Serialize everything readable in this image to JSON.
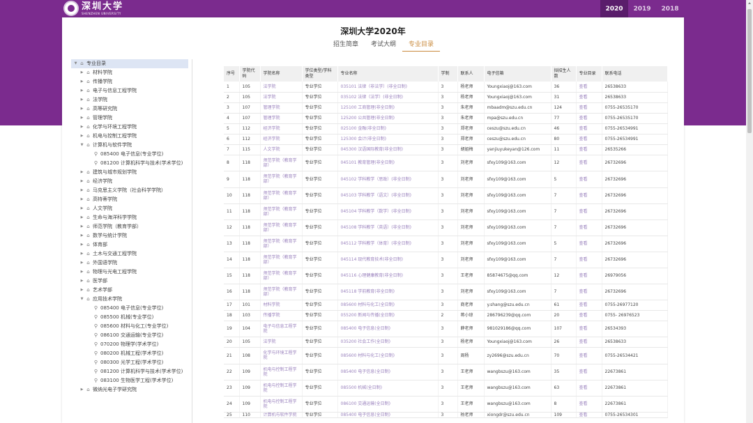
{
  "header": {
    "logo_cn": "深圳大学",
    "logo_en": "SHENZHEN UNIVERSITY",
    "years": [
      "2020",
      "2019",
      "2018"
    ],
    "active_year": "2020"
  },
  "page": {
    "title": "深圳大学2020年",
    "tabs": [
      "招生简章",
      "考试大纲",
      "专业目录"
    ],
    "active_tab": "专业目录"
  },
  "tree": {
    "root": "专业目录",
    "items": [
      {
        "label": "材料学院",
        "level": 1,
        "expanded": false
      },
      {
        "label": "传播学院",
        "level": 1,
        "expanded": false
      },
      {
        "label": "电子与信息工程学院",
        "level": 1,
        "expanded": false
      },
      {
        "label": "法学院",
        "level": 1,
        "expanded": false
      },
      {
        "label": "高等研究院",
        "level": 1,
        "expanded": false
      },
      {
        "label": "管理学院",
        "level": 1,
        "expanded": false
      },
      {
        "label": "化学与环境工程学院",
        "level": 1,
        "expanded": false
      },
      {
        "label": "机电与控制工程学院",
        "level": 1,
        "expanded": false
      },
      {
        "label": "计算机与软件学院",
        "level": 1,
        "expanded": true
      },
      {
        "label": "085400 电子信息(专业学位)",
        "level": 2
      },
      {
        "label": "081200 计算机科学与技术(学术学位)",
        "level": 2
      },
      {
        "label": "建筑与城市规划学院",
        "level": 1,
        "expanded": false
      },
      {
        "label": "经济学院",
        "level": 1,
        "expanded": false
      },
      {
        "label": "马克思主义学院（社会科学学院）",
        "level": 1,
        "expanded": false
      },
      {
        "label": "高特蒂学院",
        "level": 1,
        "expanded": false
      },
      {
        "label": "人文学院",
        "level": 1,
        "expanded": false
      },
      {
        "label": "生命与海洋科学学院",
        "level": 1,
        "expanded": false
      },
      {
        "label": "师范学院（教育学部）",
        "level": 1,
        "expanded": false
      },
      {
        "label": "数学与统计学院",
        "level": 1,
        "expanded": false
      },
      {
        "label": "体育部",
        "level": 1,
        "expanded": false
      },
      {
        "label": "土木与交通工程学院",
        "level": 1,
        "expanded": false
      },
      {
        "label": "外国语学院",
        "level": 1,
        "expanded": false
      },
      {
        "label": "物理与光电工程学院",
        "level": 1,
        "expanded": false
      },
      {
        "label": "医学部",
        "level": 1,
        "expanded": false
      },
      {
        "label": "艺术学部",
        "level": 1,
        "expanded": false
      },
      {
        "label": "应用技术学院",
        "level": 1,
        "expanded": true
      },
      {
        "label": "085400 电子信息(专业学位)",
        "level": 2
      },
      {
        "label": "085500 机械(专业学位)",
        "level": 2
      },
      {
        "label": "085600 材料与化工(专业学位)",
        "level": 2
      },
      {
        "label": "086100 交通运输(专业学位)",
        "level": 2
      },
      {
        "label": "070200 物理学(学术学位)",
        "level": 2
      },
      {
        "label": "080200 机械工程(学术学位)",
        "level": 2
      },
      {
        "label": "080300 光学工程(学术学位)",
        "level": 2
      },
      {
        "label": "081200 计算机科学与技术(学术学位)",
        "level": 2
      },
      {
        "label": "083100 生物医学工程(学术学位)",
        "level": 2
      },
      {
        "label": "微纳光电子学研究院",
        "level": 1,
        "expanded": false
      }
    ]
  },
  "table": {
    "headers": [
      "序号",
      "学院代码",
      "学院名称",
      "学位类型/学科类型",
      "专业名称",
      "学制",
      "联系人",
      "电子信箱",
      "拟招生人数",
      "专业目录",
      "联系电话"
    ],
    "rows": [
      {
        "h": 15,
        "cells": [
          "1",
          "105",
          "法学院",
          "专业学位",
          "035101 法律（非法学）(非全日制)",
          "3",
          "杨老师",
          "Youngxiaoj@163.com",
          "36",
          "查看",
          "26538633"
        ]
      },
      {
        "h": 15,
        "cells": [
          "2",
          "105",
          "法学院",
          "专业学位",
          "035102 法律（法学）(非全日制)",
          "3",
          "杨老师",
          "Youngxiaoj@163.com",
          "31",
          "查看",
          "26538633"
        ]
      },
      {
        "h": 15,
        "cells": [
          "3",
          "107",
          "管理学院",
          "专业学位",
          "125100 工商管理(非全日制)",
          "3",
          "朱老师",
          "mbaadm@szu.edu.cn",
          "124",
          "查看",
          "0755-26535170"
        ]
      },
      {
        "h": 15,
        "cells": [
          "4",
          "107",
          "管理学院",
          "专业学位",
          "125200 公共管理(非全日制)",
          "3",
          "朱老师",
          "mpa@szu.edu.cn",
          "77",
          "查看",
          "0755-26535170"
        ]
      },
      {
        "h": 15,
        "cells": [
          "5",
          "112",
          "经济学院",
          "专业学位",
          "025100 金融(非全日制)",
          "3",
          "郑老师",
          "ceszu@szu.edu.cn",
          "46",
          "查看",
          "0755-26534991"
        ]
      },
      {
        "h": 15,
        "cells": [
          "6",
          "112",
          "经济学院",
          "专业学位",
          "125300 会计(非全日制)",
          "3",
          "郑老师",
          "ceszu@szu.edu.cn",
          "80",
          "查看",
          "0755-26534991"
        ]
      },
      {
        "h": 15,
        "cells": [
          "7",
          "115",
          "人文学院",
          "专业学位",
          "045300 汉语国际教育(非全日制)",
          "3",
          "胡姐梅",
          "yanjiuyukeyan@126.com",
          "11",
          "查看",
          "26535266"
        ]
      },
      {
        "h": 23,
        "cells": [
          "8",
          "118",
          "师范学院（教育学部）",
          "专业学位",
          "045101 教育管理(非全日制)",
          "3",
          "刘老师",
          "sfxy109@163.com",
          "12",
          "查看",
          "26732696"
        ]
      },
      {
        "h": 24,
        "cells": [
          "9",
          "118",
          "师范学院（教育学部）",
          "专业学位",
          "045102 学科教学（思政）(非全日制)",
          "3",
          "刘老师",
          "sfxy109@163.com",
          "5",
          "查看",
          "26732696"
        ]
      },
      {
        "h": 23,
        "cells": [
          "10",
          "118",
          "师范学院（教育学部）",
          "专业学位",
          "045103 学科教学（语文）(非全日制)",
          "3",
          "刘老师",
          "sfxy109@163.com",
          "7",
          "查看",
          "26732696"
        ]
      },
      {
        "h": 23,
        "cells": [
          "11",
          "118",
          "师范学院（教育学部）",
          "专业学位",
          "045104 学科教学（数学）(非全日制)",
          "3",
          "刘老师",
          "sfxy109@163.com",
          "7",
          "查看",
          "26732696"
        ]
      },
      {
        "h": 23,
        "cells": [
          "12",
          "118",
          "师范学院（教育学部）",
          "专业学位",
          "045108 学科教学（英语）(非全日制)",
          "3",
          "刘老师",
          "sfxy109@163.com",
          "7",
          "查看",
          "26732696"
        ]
      },
      {
        "h": 23,
        "cells": [
          "13",
          "118",
          "师范学院（教育学部）",
          "专业学位",
          "045112 学科教学（体育）(非全日制)",
          "3",
          "刘老师",
          "sfxy109@163.com",
          "5",
          "查看",
          "26732696"
        ]
      },
      {
        "h": 23,
        "cells": [
          "14",
          "118",
          "师范学院（教育学部）",
          "专业学位",
          "045114 现代教育技术(非全日制)",
          "3",
          "刘老师",
          "sfxy109@163.com",
          "7",
          "查看",
          "26732696"
        ]
      },
      {
        "h": 23,
        "cells": [
          "15",
          "118",
          "师范学院（教育学部）",
          "专业学位",
          "045116 心理健康教育(非全日制)",
          "3",
          "王老师",
          "85874675@qq.com",
          "12",
          "查看",
          "26979056"
        ]
      },
      {
        "h": 23,
        "cells": [
          "16",
          "118",
          "师范学院（教育学部）",
          "专业学位",
          "045118 学前教育(非全日制)",
          "3",
          "刘老师",
          "sfxy109@163.com",
          "7",
          "查看",
          "26732696"
        ]
      },
      {
        "h": 15,
        "cells": [
          "17",
          "101",
          "材料学院",
          "专业学位",
          "085600 材料与化工(全日制)",
          "3",
          "商老师",
          "y.shang@szu.edu.cn",
          "61",
          "查看",
          "0755-26977120"
        ]
      },
      {
        "h": 15,
        "cells": [
          "18",
          "103",
          "传播学院",
          "专业学位",
          "055200 新闻与传播(全日制)",
          "2",
          "蒋小琼",
          "286796239@qq.com",
          "20",
          "查看",
          "0755- 26976523"
        ]
      },
      {
        "h": 23,
        "cells": [
          "19",
          "104",
          "电子与信息工程学院",
          "专业学位",
          "085400 电子信息(全日制)",
          "3",
          "薛老师",
          "981029186@qq.com",
          "107",
          "查看",
          "26534393"
        ]
      },
      {
        "h": 15,
        "cells": [
          "20",
          "105",
          "法学院",
          "专业学位",
          "035200 社会工作(全日制)",
          "3",
          "杨老师",
          "Youngxiaoj@163.com",
          "26",
          "查看",
          "26538633"
        ]
      },
      {
        "h": 24,
        "cells": [
          "21",
          "108",
          "化学与环境工程学院",
          "专业学位",
          "085600 材料与化工(全日制)",
          "3",
          "周杨",
          "zy2696@szu.edu.cn",
          "70",
          "查看",
          "0755-26534421"
        ]
      },
      {
        "h": 23,
        "cells": [
          "22",
          "109",
          "机电与控制工程学院",
          "专业学位",
          "085400 电子信息(全日制)",
          "3",
          "王老师",
          "wangbszu@163.com",
          "35",
          "查看",
          "22673861"
        ]
      },
      {
        "h": 23,
        "cells": [
          "23",
          "109",
          "机电与控制工程学院",
          "专业学位",
          "085500 机械(全日制)",
          "3",
          "王老师",
          "wangbszu@163.com",
          "63",
          "查看",
          "22673861"
        ]
      },
      {
        "h": 23,
        "cells": [
          "24",
          "109",
          "机电与控制工程学院",
          "专业学位",
          "086100 交通运输(全日制)",
          "3",
          "王老师",
          "wangbszu@163.com",
          "8",
          "查看",
          "22673861"
        ]
      },
      {
        "h": 8,
        "cells": [
          "25",
          "110",
          "计算机与软件学院",
          "专业学位",
          "085400 电子信息(全日制)",
          "3",
          "杨老师",
          "xiongdr@szu.edu.cn",
          "109",
          "查看",
          "0755-26534301"
        ]
      }
    ]
  },
  "colors": {
    "brand_purple": "#7b2b8e",
    "active_tab_orange": "#c98a3c",
    "link_purple": "#9a82bd"
  }
}
